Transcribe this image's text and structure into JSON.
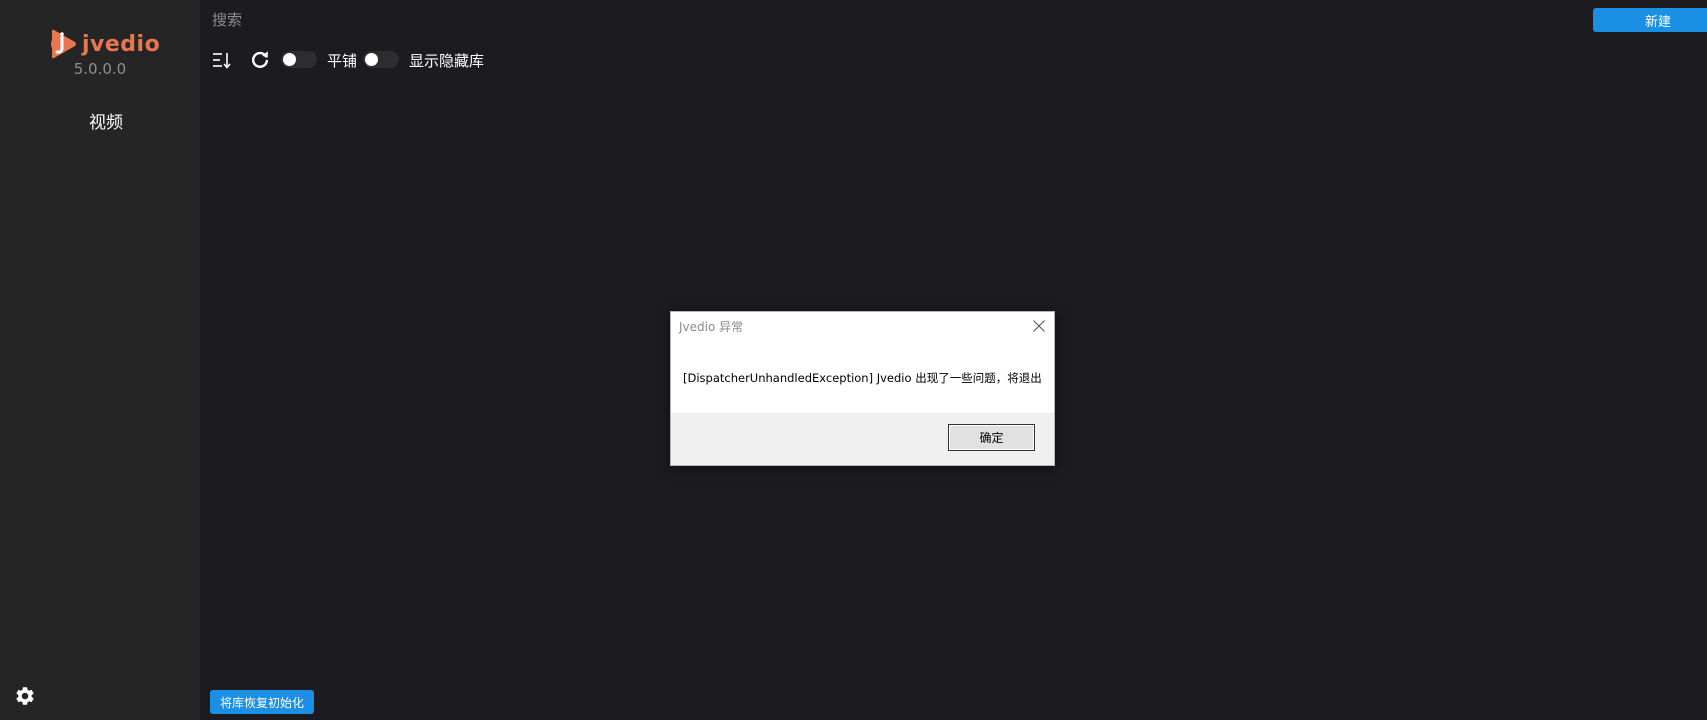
{
  "app": {
    "name": "jvedio",
    "version": "5.0.0.0",
    "brand_color": "#e8774f",
    "accent_color": "#1a8fe3"
  },
  "sidebar": {
    "items": [
      {
        "label": "视频",
        "icon": "none"
      }
    ],
    "settings_icon": "gear-icon"
  },
  "header": {
    "search": {
      "placeholder": "搜索",
      "value": ""
    },
    "new_button": "新建"
  },
  "toolbar": {
    "sort_icon": "sort-icon",
    "refresh_icon": "refresh-icon",
    "toggles": [
      {
        "label": "平铺",
        "on": false
      },
      {
        "label": "显示隐藏库",
        "on": false
      }
    ]
  },
  "footer": {
    "reset_button": "将库恢复初始化"
  },
  "dialog": {
    "title": "Jvedio 异常",
    "message": "[DispatcherUnhandledException] Jvedio 出现了一些问题，将退出",
    "ok_button": "确定",
    "close_icon": "close-icon"
  }
}
